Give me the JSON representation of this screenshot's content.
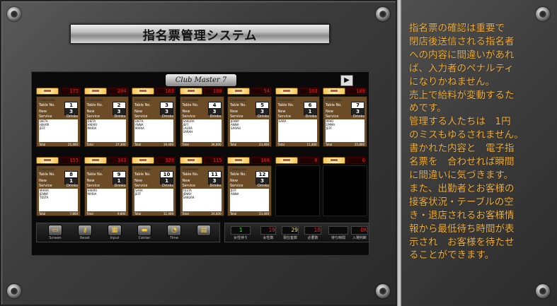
{
  "title": "指名票管理システム",
  "app": {
    "logo_text": "Club Master 7",
    "play_icon": "▶"
  },
  "colors": {
    "description_text": "#f4b33e",
    "card_bg": "#6b4c27",
    "timer_text": "#e22222",
    "stat_green": "#3ce23c",
    "stat_red": "#e22222",
    "stat_yellow": "#f0e040"
  },
  "tables_row1": [
    {
      "timer": "175",
      "table_no": "1",
      "guests": "3",
      "names": [
        "DIETA",
        "HIKARI",
        "JEFF"
      ],
      "total": "25,400"
    },
    {
      "timer": "204",
      "table_no": "2",
      "guests": "3",
      "names": [
        "DIETA",
        "HIKARI",
        "MARIA"
      ],
      "total": "27,300"
    },
    {
      "timer": "163",
      "table_no": "3",
      "guests": "3",
      "names": [
        "DIETA",
        "ANNA",
        "MARIA"
      ],
      "total": "19,400"
    },
    {
      "timer": "100",
      "table_no": "4",
      "guests": "3",
      "names": [
        "SAKURA",
        "JEFF",
        "LAURA",
        "SARAH"
      ],
      "total": "26,000"
    },
    {
      "timer": "54",
      "table_no": "5",
      "guests": "3",
      "names": [
        "JENNY",
        "ANNA",
        "SARAH"
      ],
      "total": "23,400"
    },
    {
      "timer": "103",
      "table_no": "6",
      "guests": "1",
      "names": [
        "SARA"
      ],
      "total": "11,400"
    },
    {
      "timer": "109",
      "table_no": "7",
      "guests": "3",
      "names": [
        "MAKI",
        "EMMA",
        "JEFF"
      ],
      "total": "25,800"
    }
  ],
  "tables_row2": [
    {
      "timer": "155",
      "table_no": "8",
      "guests": "1",
      "names": [
        "MARIA",
        "JENNY",
        "TESTA"
      ],
      "total": "7,800"
    },
    {
      "timer": "143",
      "table_no": "9",
      "guests": "1",
      "names": [
        "HIKARI",
        "MARIA"
      ],
      "total": "9,800"
    },
    {
      "timer": "329",
      "table_no": "10",
      "guests": "1",
      "names": [
        "SARA",
        "JEFF"
      ],
      "total": "11,400"
    },
    {
      "timer": "115",
      "table_no": "11",
      "guests": "3",
      "names": [
        "TESTA",
        "JENNY",
        "SAKURA"
      ],
      "total": "24,600"
    },
    {
      "timer": "108",
      "table_no": "12",
      "guests": "3",
      "names": [
        "JEFF",
        "ANNA"
      ],
      "total": "23,400"
    },
    {
      "timer": "0",
      "empty": true
    },
    {
      "timer": "0",
      "empty": true
    }
  ],
  "card_labels": {
    "header": "Clubmaster",
    "sub": "Table No.",
    "new": "New",
    "service": "Service",
    "drinks": "Drinks",
    "total": "Total"
  },
  "toolbar": [
    {
      "label": "Screen",
      "icon": "screen-icon",
      "glyph": "▭"
    },
    {
      "label": "Reset",
      "icon": "key-icon",
      "glyph": "⚷"
    },
    {
      "label": "Input",
      "icon": "keypad-icon",
      "glyph": "▦"
    },
    {
      "label": "Center",
      "icon": "center-icon",
      "glyph": "▬"
    },
    {
      "label": "Time",
      "icon": "clock-icon",
      "glyph": "◔"
    },
    {
      "label": "",
      "icon": "document-icon",
      "glyph": "▤"
    }
  ],
  "stats": [
    {
      "label": "女性待り",
      "value": "1",
      "color": "#3ce23c"
    },
    {
      "label": "女性数",
      "value": "19",
      "color": "#e22222"
    },
    {
      "label": "現在客数",
      "value": "29",
      "color": "#f0e040"
    },
    {
      "label": "必要数",
      "value": "18",
      "color": "#e22222"
    },
    {
      "label": "待ち時間",
      "value": "",
      "color": "#e22222"
    },
    {
      "label": "入場判断",
      "value": "0K",
      "color": "#e22222"
    }
  ],
  "description": "指名票の確認は重要で\n閉店後送信される指名者\nへの内容に間違いがあれ\nば、入力者のペナルティ\nになりかねません。\n売上で給料が変動するた\nめです。\n管理する人たちは　1円\nのミスもゆるされません。\n書かれた内容と　電子指\n名票を　合わせれば瞬間\nに間違いに気づきます。\nまた、出勤者とお客様の\n接客状況・テーブルの空\nき・退店されるお客様情\n報から最低待ち時間が表\n示され　お客様を待たせ\nることができます。"
}
